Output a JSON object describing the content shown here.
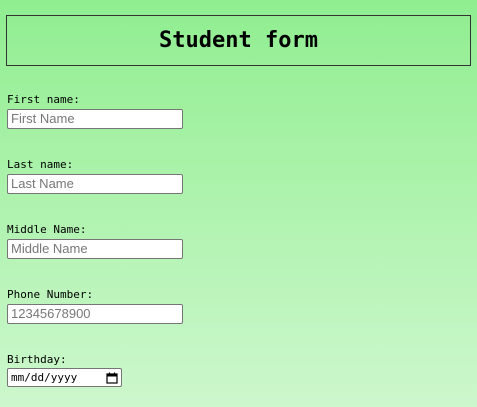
{
  "form": {
    "title": "Student form",
    "first_name": {
      "label": "First name:",
      "placeholder": "First Name"
    },
    "last_name": {
      "label": "Last name:",
      "placeholder": "Last Name"
    },
    "middle_name": {
      "label": "Middle Name:",
      "placeholder": "Middle Name"
    },
    "phone": {
      "label": "Phone Number:",
      "placeholder": "12345678900"
    },
    "birthday": {
      "label": "Birthday:",
      "value": "mm/dd/yyyy",
      "icon": "calendar-icon"
    }
  },
  "colors": {
    "background_top": "#90ee90",
    "background_bottom": "#cdf7cd"
  }
}
